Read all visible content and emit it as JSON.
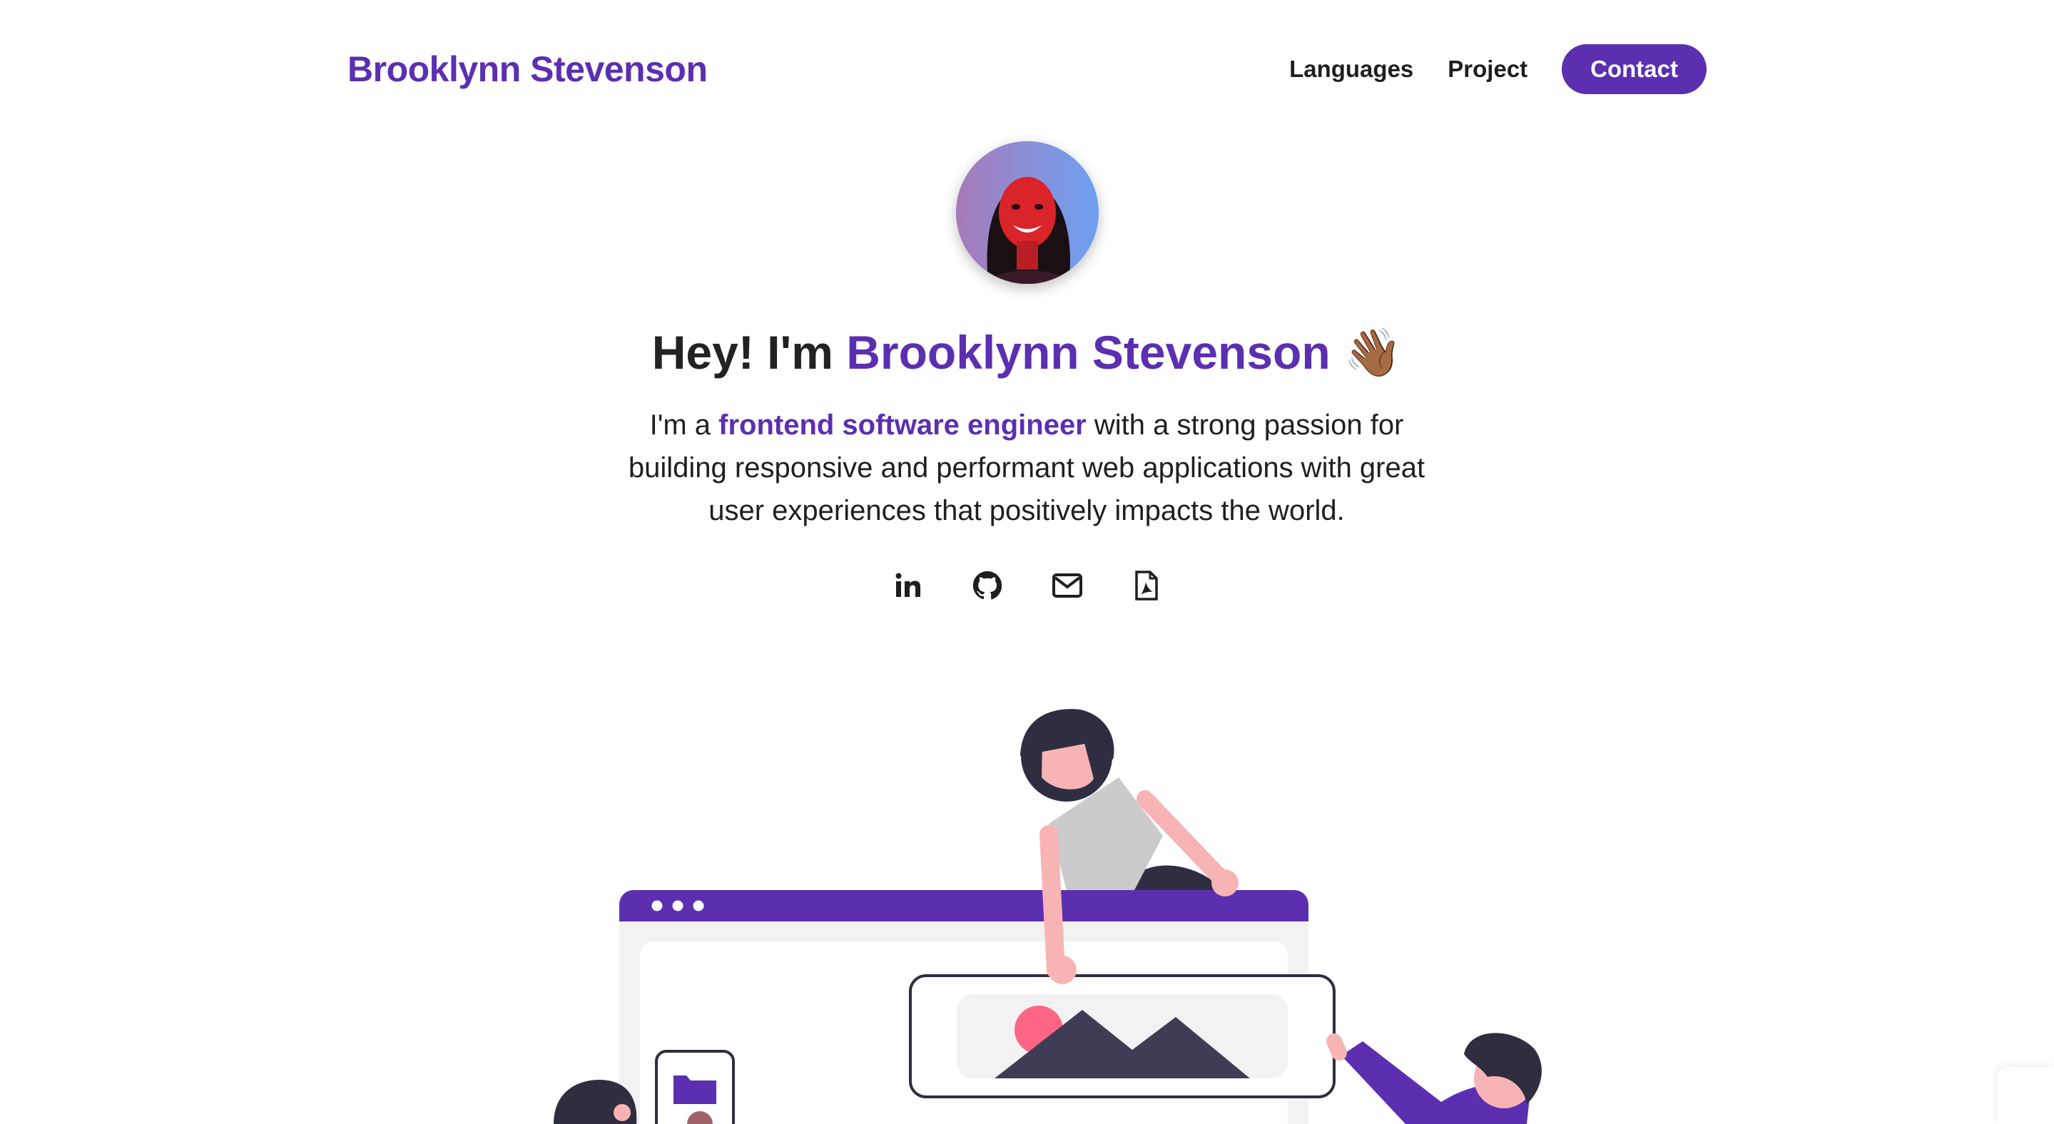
{
  "header": {
    "brand": "Brooklynn Stevenson",
    "nav": {
      "languages": "Languages",
      "project": "Project",
      "contact": "Contact"
    }
  },
  "hero": {
    "greeting_prefix": "Hey! I'm ",
    "greeting_name": "Brooklynn Stevenson",
    "greeting_emoji": "👋🏾",
    "tagline_prefix": "I'm a ",
    "tagline_role": "frontend software engineer",
    "tagline_rest": " with a strong passion for building responsive and performant web applications with great user experiences that positively impacts the world."
  },
  "socials": [
    {
      "icon": "linkedin-icon"
    },
    {
      "icon": "github-icon"
    },
    {
      "icon": "mail-icon"
    },
    {
      "icon": "pdf-resume-icon"
    }
  ],
  "colors": {
    "accent": "#5b2fb0",
    "text": "#1f1f1f",
    "skin": "#f8b4b4",
    "hair": "#2f2e41"
  }
}
